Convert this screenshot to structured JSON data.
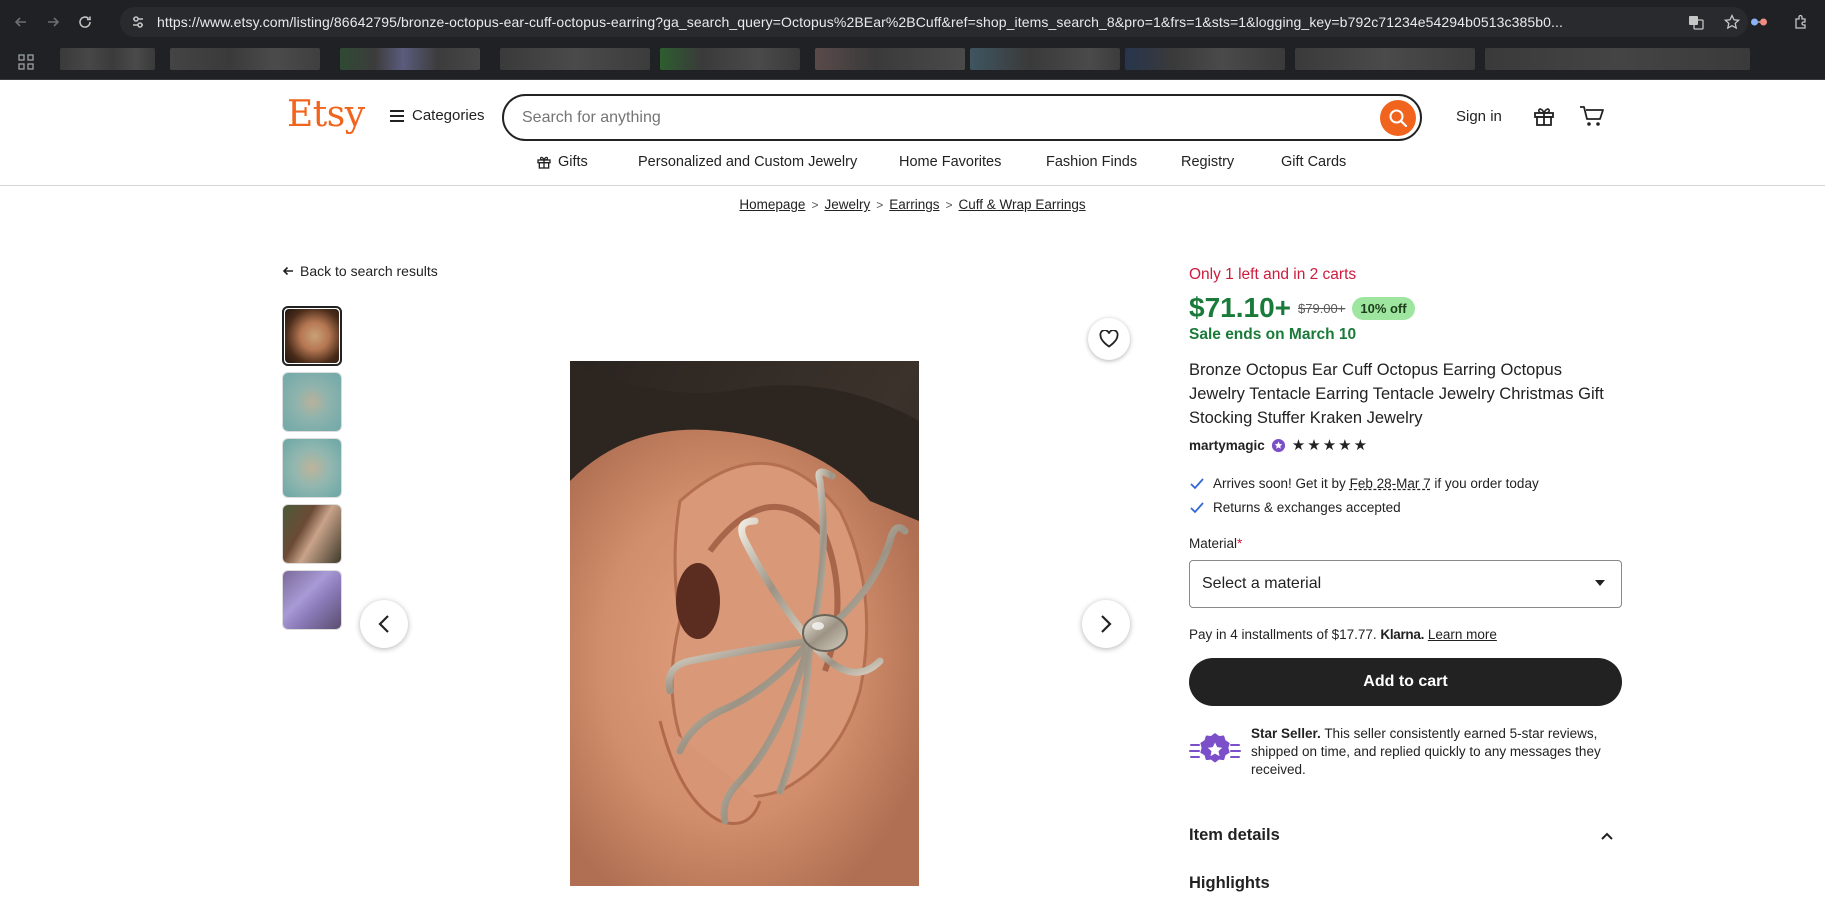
{
  "browser": {
    "url": "https://www.etsy.com/listing/86642795/bronze-octopus-ear-cuff-octopus-earring?ga_search_query=Octopus%2BEar%2BCuff&ref=shop_items_search_8&pro=1&frs=1&sts=1&logging_key=b792c71234e54294b0513c385b0..."
  },
  "header": {
    "logo": "Etsy",
    "categories_label": "Categories",
    "search_placeholder": "Search for anything",
    "signin_label": "Sign in"
  },
  "subnav": {
    "items": [
      "Gifts",
      "Personalized and Custom Jewelry",
      "Home Favorites",
      "Fashion Finds",
      "Registry",
      "Gift Cards"
    ]
  },
  "breadcrumb": {
    "items": [
      "Homepage",
      "Jewelry",
      "Earrings",
      "Cuff & Wrap Earrings"
    ]
  },
  "gallery": {
    "back_label": "Back to search results",
    "thumb_count": 5
  },
  "listing": {
    "stock_message": "Only 1 left and in 2 carts",
    "price": "$71.10+",
    "original_price": "$79.00+",
    "discount": "10% off",
    "sale_ends": "Sale ends on March 10",
    "title": "Bronze Octopus Ear Cuff Octopus Earring Octopus Jewelry Tentacle Earring Tentacle Jewelry Christmas Gift Stocking Stuffer Kraken Jewelry",
    "seller": "martymagic",
    "rating_stars": 5,
    "arrival_prefix": "Arrives soon! Get it by",
    "arrival_dates": "Feb 28-Mar 7",
    "arrival_suffix": "if you order today",
    "returns": "Returns & exchanges accepted",
    "material_label": "Material",
    "material_required": "*",
    "material_select": "Select a material",
    "klarna_text": "Pay in 4 installments of $17.77.",
    "klarna_brand": "Klarna.",
    "klarna_link": "Learn more",
    "add_to_cart": "Add to cart",
    "star_seller_title": "Star Seller.",
    "star_seller_text": "This seller consistently earned 5-star reviews, shipped on time, and replied quickly to any messages they received.",
    "item_details": "Item details",
    "highlights": "Highlights"
  },
  "colors": {
    "brand": "#f1641e",
    "price_green": "#1a7a3a",
    "alert_red": "#cc1c3c",
    "discount_bg": "#9ee59f",
    "star_seller_purple": "#7b4fc9"
  }
}
